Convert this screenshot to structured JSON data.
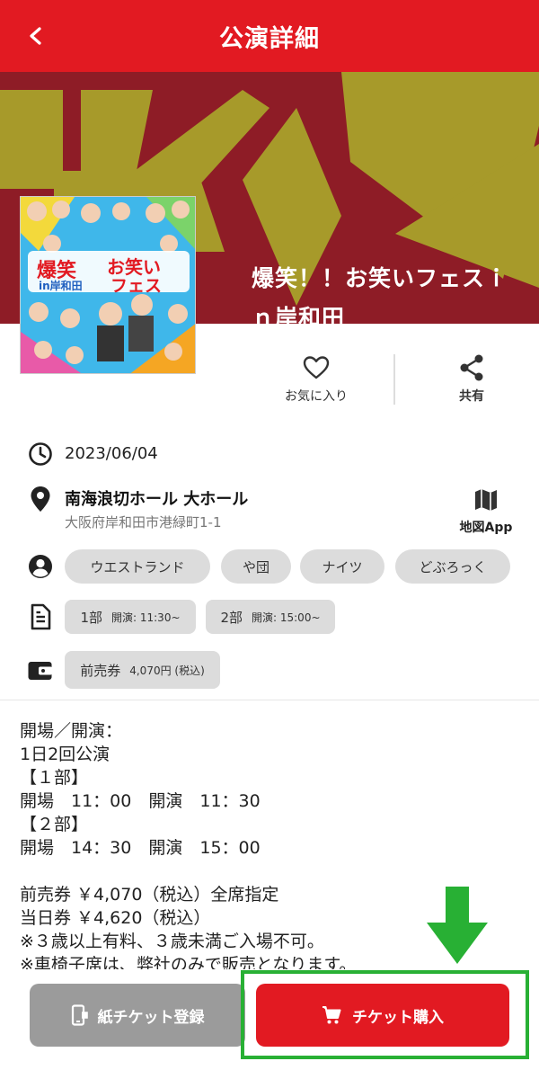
{
  "header": {
    "title": "公演詳細"
  },
  "hero": {
    "title": "爆笑！！お笑いフェスｉｎ岸和田"
  },
  "poster": {
    "title_lines": [
      "爆笑",
      "お笑い",
      "フェス"
    ],
    "sub_label": "in岸和田"
  },
  "actions": {
    "favorite": "お気に入り",
    "share": "共有"
  },
  "date": "2023/06/04",
  "venue": {
    "name": "南海浪切ホール 大ホール",
    "address": "大阪府岸和田市港緑町1-1",
    "map_label": "地図App"
  },
  "performers": [
    "ウエストランド",
    "や団",
    "ナイツ",
    "どぶろっく"
  ],
  "sessions": [
    {
      "label": "1部",
      "time": "開演: 11:30~"
    },
    {
      "label": "2部",
      "time": "開演: 15:00~"
    }
  ],
  "ticket": {
    "label": "前売券",
    "price": "4,070円 (税込)"
  },
  "description": "開場／開演：\n1日2回公演\n【１部】\n開場　11：00　開演　11：30\n【２部】\n開場　14：30　開演　15：00\n\n前売券 ￥4,070（税込）全席指定\n当日券 ￥4,620（税込）\n※３歳以上有料、３歳未満ご入場不可。\n※車椅子席は、弊社のみで販売となります。",
  "buttons": {
    "paper_ticket": "紙チケット登録",
    "buy_ticket": "チケット購入"
  },
  "colors": {
    "brand_red": "#e21a22",
    "hero_bg": "#8e1c26",
    "hero_shape": "#a79a2a",
    "highlight_green": "#28b034"
  },
  "icons": [
    "back-icon",
    "heart-icon",
    "share-icon",
    "clock-icon",
    "location-pin-icon",
    "map-icon",
    "person-icon",
    "document-icon",
    "wallet-icon",
    "phone-ticket-icon",
    "cart-icon",
    "down-arrow-icon"
  ]
}
